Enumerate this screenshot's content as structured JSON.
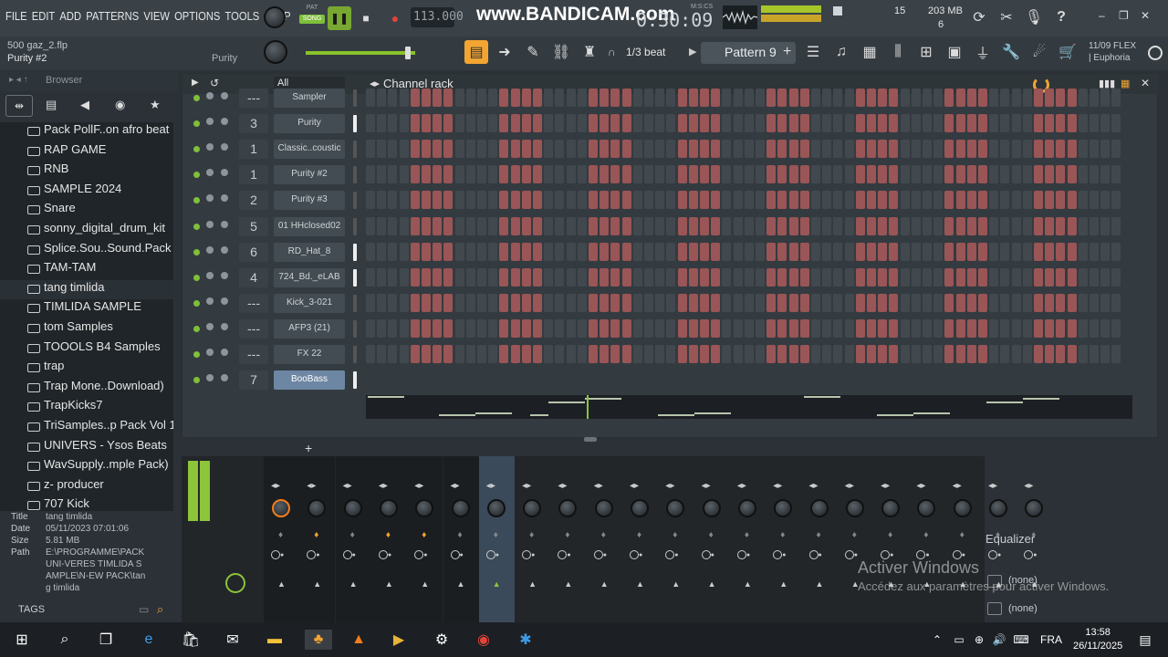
{
  "menu": [
    "FILE",
    "EDIT",
    "ADD",
    "PATTERNS",
    "VIEW",
    "OPTIONS",
    "TOOLS",
    "HELP"
  ],
  "transport": {
    "pat_label": "PAT",
    "song_label": "SONG",
    "tempo": "113.000",
    "timer": "0:30:09",
    "timer_unit": "M:S:CS"
  },
  "watermark": "www.BANDICAM.com",
  "cpu": {
    "memory": "203 MB",
    "value1": "15",
    "value2": "6"
  },
  "project": {
    "filename": "500 gaz_2.flp",
    "channel": "Purity #2",
    "hint_channel": "Purity"
  },
  "toolbar": {
    "beat": "1/3 beat",
    "pattern": "Pattern 9"
  },
  "flex": {
    "line1": "11/09  FLEX",
    "line2": "| Euphoria"
  },
  "browser": {
    "title": "Browser",
    "items": [
      {
        "label": "Pack PollF..on afro beat"
      },
      {
        "label": "RAP GAME"
      },
      {
        "label": "RNB"
      },
      {
        "label": "SAMPLE 2024"
      },
      {
        "label": "Snare"
      },
      {
        "label": "sonny_digital_drum_kit"
      },
      {
        "label": "Splice.Sou..Sound.Pack"
      },
      {
        "label": "TAM-TAM"
      },
      {
        "label": "tang timlida"
      },
      {
        "label": "TIMLIDA SAMPLE"
      },
      {
        "label": "tom Samples"
      },
      {
        "label": "TOOOLS B4 Samples"
      },
      {
        "label": "trap"
      },
      {
        "label": "Trap Mone..Download)"
      },
      {
        "label": "TrapKicks7"
      },
      {
        "label": "TriSamples..p Pack Vol 1"
      },
      {
        "label": "UNIVERS - Ysos Beats"
      },
      {
        "label": "WavSupply..mple Pack)"
      },
      {
        "label": "z- producer"
      },
      {
        "label": "707 Kick"
      }
    ],
    "selected_index": 8
  },
  "info": {
    "title_key": "Title",
    "title": "tang timlida",
    "date_key": "Date",
    "date": "05/11/2023 07:01:06",
    "size_key": "Size",
    "size": "5.81 MB",
    "path_key": "Path",
    "path": "E:\\PROGRAMME\\PACK UNI-VERES TIMLIDA SAMPLE\\N-EW PACK\\tang timlida"
  },
  "tags_label": "TAGS",
  "channel_rack": {
    "title": "Channel rack",
    "filter": "All",
    "channels": [
      {
        "num": "---",
        "name": "Sampler",
        "sel": false
      },
      {
        "num": "3",
        "name": "Purity",
        "sel": true
      },
      {
        "num": "1",
        "name": "Classic..coustic",
        "sel": false
      },
      {
        "num": "1",
        "name": "Purity #2",
        "sel": false
      },
      {
        "num": "2",
        "name": "Purity #3",
        "sel": false
      },
      {
        "num": "5",
        "name": "01 HHclosed02",
        "sel": false
      },
      {
        "num": "6",
        "name": "RD_Hat_8",
        "sel": true
      },
      {
        "num": "4",
        "name": "724_Bd._eLAB",
        "sel": true
      },
      {
        "num": "---",
        "name": "Kick_3-021",
        "sel": false
      },
      {
        "num": "---",
        "name": "AFP3 (21)",
        "sel": false
      },
      {
        "num": "---",
        "name": "FX 22",
        "sel": false
      },
      {
        "num": "7",
        "name": "BooBass",
        "sel": true
      }
    ]
  },
  "mixer_panel": {
    "eq_label": "Equalizer",
    "slot1": "(none)",
    "slot2": "(none)"
  },
  "watermark_windows": {
    "line1": "Activer Windows",
    "line2": "Accédez aux paramètres pour activer Windows."
  },
  "taskbar": {
    "lang": "FRA",
    "time": "13:58",
    "date": "26/11/2025"
  }
}
